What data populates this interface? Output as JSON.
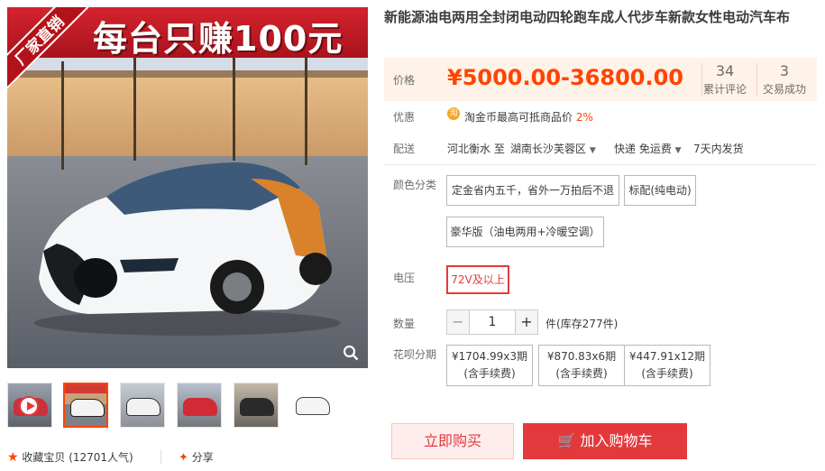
{
  "product": {
    "title": "新能源油电两用全封闭电动四轮跑车成人代步车新款女性电动汽车布",
    "image_banner": "每台只赚100元",
    "image_ribbon": "厂家直销"
  },
  "price_section": {
    "label": "价格",
    "value": "¥5000.00-36800.00",
    "reviews_count": "34",
    "reviews_label": "累计评论",
    "sold_count": "3",
    "sold_label": "交易成功"
  },
  "promo": {
    "label": "优惠",
    "coin_icon": "淘",
    "text": "淘金币最高可抵商品价",
    "percent": "2%"
  },
  "shipping": {
    "label": "配送",
    "from": "河北衡水 至",
    "to": "湖南长沙芙蓉区",
    "method": "快递 免运费",
    "time": "7天内发货"
  },
  "color": {
    "label": "颜色分类",
    "options": [
      "定金省内五千，省外一万拍后不退",
      "标配(纯电动)",
      "豪华版（油电两用+冷暖空调）"
    ]
  },
  "voltage": {
    "label": "电压",
    "options": [
      "72V及以上"
    ]
  },
  "quantity": {
    "label": "数量",
    "minus": "−",
    "value": "1",
    "plus": "+",
    "stock": "件(库存277件)"
  },
  "installment": {
    "label": "花呗分期",
    "plans": [
      {
        "amount": "¥1704.99x3期",
        "fee": "(含手续费)"
      },
      {
        "amount": "¥870.83x6期",
        "fee": "(含手续费)"
      },
      {
        "amount": "¥447.91x12期",
        "fee": "(含手续费)"
      }
    ]
  },
  "actions": {
    "buy_now": "立即购买",
    "add_to_cart": "加入购物车"
  },
  "social": {
    "favorite": "收藏宝贝 (12701人气)",
    "share": "分享"
  },
  "colors": {
    "accent": "#ff4400",
    "button_red": "#e4393c",
    "price_bg": "#fff2e8"
  }
}
